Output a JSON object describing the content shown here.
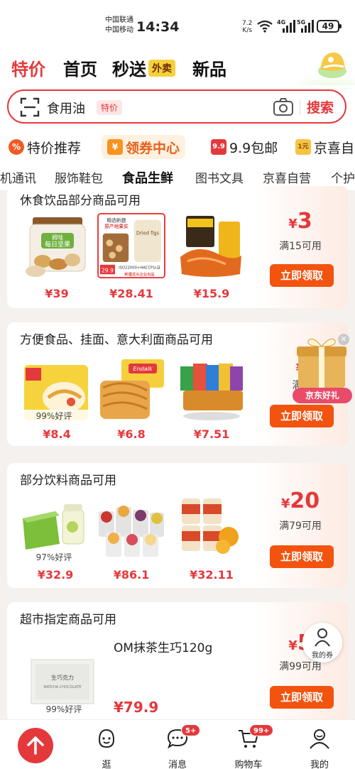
{
  "status": {
    "carrier1": "中国联通",
    "carrier2": "中国移动",
    "time": "14:34",
    "speed_value": "7.2",
    "speed_unit": "K/s",
    "signal1_tag": "4G",
    "signal2_tag": "5G",
    "battery": "49"
  },
  "topnav": {
    "tabs": [
      "特价",
      "首页",
      "秒送",
      "新品"
    ],
    "waimai_badge": "外卖"
  },
  "search": {
    "query": "食用油",
    "tag": "特价",
    "button": "搜索"
  },
  "features": [
    "特价推荐",
    "领券中心",
    "9.9包邮",
    "京喜自"
  ],
  "feature_icons": [
    "%",
    "¥",
    "9.9",
    "1元"
  ],
  "categories": [
    "机通讯",
    "服饰鞋包",
    "食品生鲜",
    "图书文具",
    "京喜自营",
    "个护"
  ],
  "coupons": [
    {
      "title": "休食饮品部分商品可用",
      "products": [
        {
          "price": "¥39",
          "rating": ""
        },
        {
          "price": "¥28.41",
          "rating": ""
        },
        {
          "price": "¥15.9",
          "rating": ""
        }
      ],
      "amount": "3",
      "condition": "满15可用",
      "button": "立即领取"
    },
    {
      "title": "方便食品、挂面、意大利面商品可用",
      "products": [
        {
          "price": "¥8.4",
          "rating": "99%好评"
        },
        {
          "price": "¥6.8",
          "rating": ""
        },
        {
          "price": "¥7.51",
          "rating": ""
        }
      ],
      "amount": "",
      "condition": "满3",
      "button": "立即领取"
    },
    {
      "title": "部分饮料商品可用",
      "products": [
        {
          "price": "¥32.9",
          "rating": "97%好评"
        },
        {
          "price": "¥86.1",
          "rating": ""
        },
        {
          "price": "¥32.11",
          "rating": ""
        }
      ],
      "amount": "20",
      "condition": "满79可用",
      "button": "立即领取"
    },
    {
      "title": "超市指定商品可用",
      "product_name": "OM抹茶生巧120g",
      "products": [
        {
          "price": "¥79.9",
          "rating": "99%好评"
        }
      ],
      "amount": "5",
      "condition": "满99可用",
      "button": "立即领取"
    }
  ],
  "product_pack_text": {
    "nuts_brand": "姆哇",
    "nuts_name": "每日坚果",
    "fig_line1": "精选新疆",
    "fig_line2": "原产地果实",
    "fig_brand": "Dried figs",
    "fig_price": "29.9",
    "fig_cert": "ISO22000+HACCP认证",
    "fig_footer": "新疆龙头企业出品",
    "noodle_brand": "Endalk",
    "choc_line1": "生巧克力",
    "choc_line2": "MATCHA CHOCOLATE"
  },
  "gift_label": "京东好礼",
  "my_coupon": "我的券",
  "bottom_tabs": [
    {
      "label": "逛",
      "badge": ""
    },
    {
      "label": "消息",
      "badge": "5+"
    },
    {
      "label": "购物车",
      "badge": "99+"
    },
    {
      "label": "我的",
      "badge": ""
    }
  ],
  "colors": {
    "accent": "#e4393c",
    "claim_button": "#f2530f",
    "gift_label": "#e94b6b"
  },
  "icons": [
    "scan-icon",
    "camera-icon",
    "gift-box-icon",
    "my-coupon-icon",
    "home-arrow-icon",
    "browse-icon",
    "message-icon",
    "cart-icon",
    "profile-icon"
  ]
}
